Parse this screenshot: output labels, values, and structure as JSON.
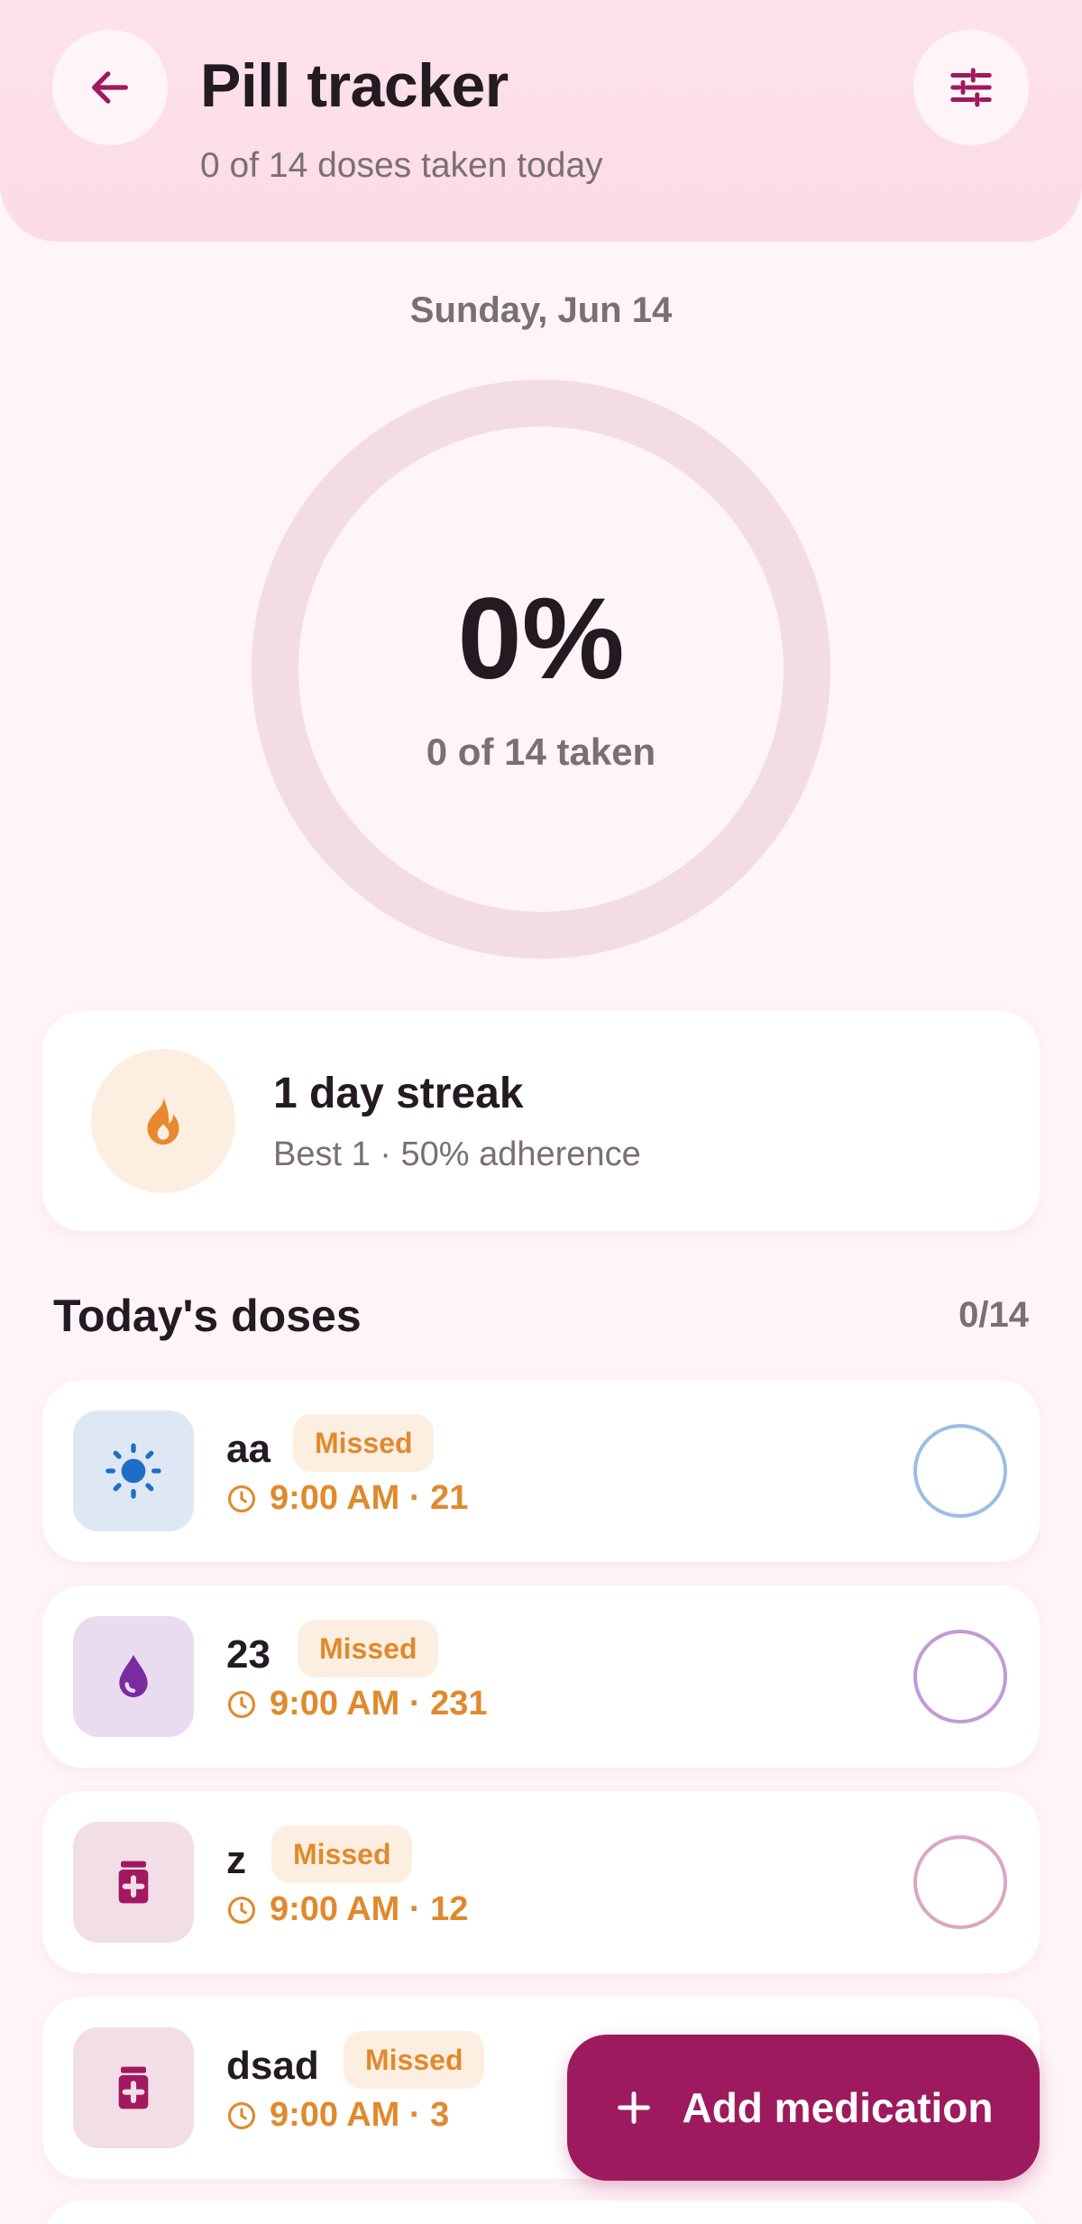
{
  "header": {
    "title": "Pill tracker",
    "subtitle": "0 of 14 doses taken today",
    "back_icon": "arrow-left-icon",
    "filter_icon": "sliders-icon"
  },
  "summary": {
    "date": "Sunday, Jun 14",
    "percent": "0%",
    "taken_text": "0 of 14 taken",
    "progress_fraction": 0
  },
  "streak": {
    "icon": "flame-icon",
    "title": "1 day streak",
    "subtitle": "Best 1 · 50% adherence"
  },
  "doses_section": {
    "title": "Today's doses",
    "count": "0/14"
  },
  "doses": [
    {
      "name": "aa",
      "status": "Missed",
      "time": "9:00 AM · 21",
      "icon": "sun-icon",
      "icon_bg": "#dde8f4",
      "icon_color": "#1e6ec8",
      "ring_color": "#9fbde3"
    },
    {
      "name": "23",
      "status": "Missed",
      "time": "9:00 AM · 231",
      "icon": "drop-icon",
      "icon_bg": "#eadcf0",
      "icon_color": "#7b2ba2",
      "ring_color": "#c19ad8"
    },
    {
      "name": "z",
      "status": "Missed",
      "time": "9:00 AM · 12",
      "icon": "medicine-bottle-icon",
      "icon_bg": "#f2dee7",
      "icon_color": "#a3195f",
      "ring_color": "#dba7c2"
    },
    {
      "name": "dsad",
      "status": "Missed",
      "time": "9:00 AM · 3",
      "icon": "medicine-bottle-icon",
      "icon_bg": "#f2dee7",
      "icon_color": "#a3195f",
      "ring_color": "#dba7c2"
    }
  ],
  "fab": {
    "label": "Add medication",
    "icon": "plus-icon"
  },
  "colors": {
    "accent": "#9e1a5e",
    "missed": "#e08a2d",
    "ring_track": "#f3dce6"
  }
}
